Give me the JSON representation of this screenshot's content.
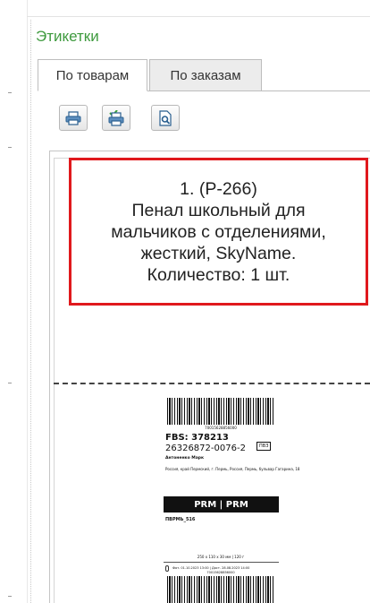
{
  "section": {
    "title": "Этикетки"
  },
  "tabs": [
    {
      "label": "По товарам",
      "active": true
    },
    {
      "label": "По заказам",
      "active": false
    }
  ],
  "toolbar": [
    {
      "name": "print-icon"
    },
    {
      "name": "print-settings-icon"
    },
    {
      "name": "print-preview-icon"
    }
  ],
  "label": {
    "lines": [
      "1.  (Р-266)",
      "Пенал школьный для",
      "мальчиков с отделениями,",
      "жесткий, SkyName.",
      "Количество: 1 шт."
    ],
    "border_color": "#e0191d"
  },
  "sticker": {
    "barcode_number": "70015628856000",
    "fbs": "FBS: 378213",
    "order": "26326872-0076-2",
    "tag": "ПВЗ",
    "recipient": "Антоненко Марк",
    "address": "Россия, край Пермский, г. Пермь, Россия, Пермь, бульвар Гагарина, 18",
    "prm": "PRM | PRM",
    "code": "ПВРМЬ_516",
    "dims": "250 x 110 x 30 мм | 120 г",
    "dates": "Фот. 01.10.2023 13:00 | Дост. 28.08.2023 14:00",
    "barcode_number_2": "70015628856000"
  },
  "colors": {
    "accent_green": "#3e9a3e"
  }
}
